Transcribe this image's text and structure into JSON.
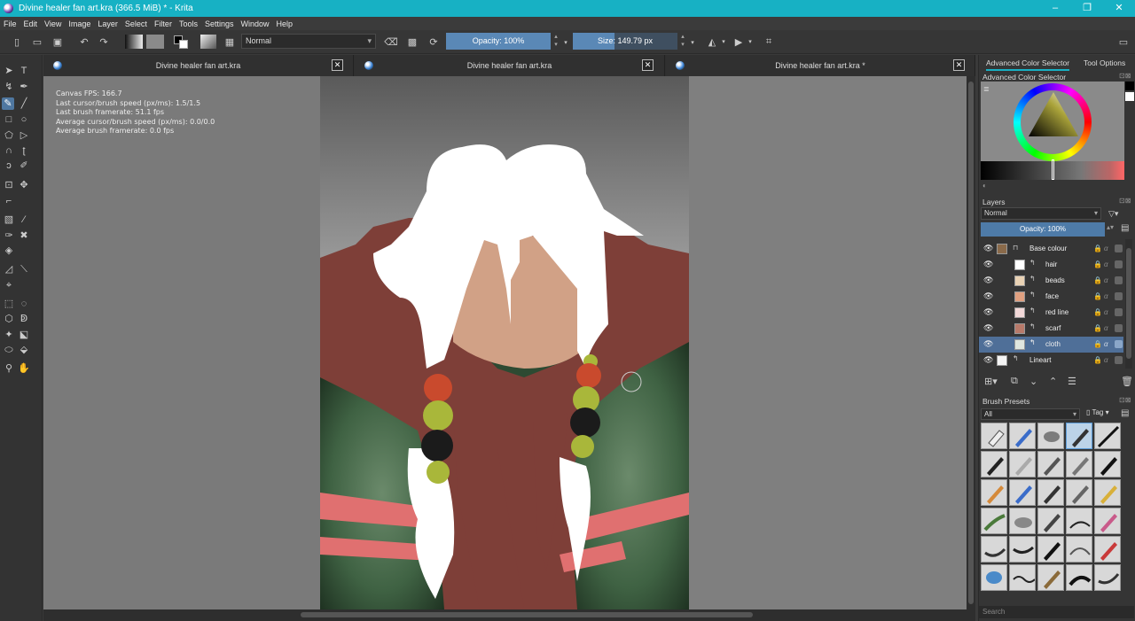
{
  "window": {
    "title": "Divine healer fan art.kra (366.5 MiB)  * - Krita",
    "controls": [
      "–",
      "❐",
      "✕"
    ]
  },
  "menu": [
    "File",
    "Edit",
    "View",
    "Image",
    "Layer",
    "Select",
    "Filter",
    "Tools",
    "Settings",
    "Window",
    "Help"
  ],
  "toolbar": {
    "blend_mode": "Normal",
    "opacity_label": "Opacity:  100%",
    "opacity_value": 1.0,
    "size_label": "Size:  149.79 px",
    "size_fill_fraction": 0.4
  },
  "documents": [
    {
      "title": "Divine healer fan art.kra"
    },
    {
      "title": "Divine healer fan art.kra"
    },
    {
      "title": "Divine healer fan art.kra *"
    }
  ],
  "stats": [
    "Canvas FPS: 166.7",
    "Last cursor/brush speed (px/ms): 1.5/1.5",
    "Last brush framerate: 51.1 fps",
    "Average cursor/brush speed (px/ms): 0.0/0.0",
    "Average brush framerate: 0.0 fps"
  ],
  "dock": {
    "tabs": [
      "Advanced Color Selector",
      "Tool Options"
    ],
    "color_selector_title": "Advanced Color Selector",
    "layers_title": "Layers",
    "layers_blend": "Normal",
    "layers_opacity": "Opacity:  100%",
    "layers": [
      {
        "name": "Base colour",
        "kind": "group",
        "selected": false
      },
      {
        "name": "hair",
        "kind": "paint",
        "selected": false
      },
      {
        "name": "beads",
        "kind": "paint",
        "selected": false
      },
      {
        "name": "face",
        "kind": "paint",
        "selected": false
      },
      {
        "name": "red line",
        "kind": "paint",
        "selected": false
      },
      {
        "name": "scarf",
        "kind": "paint",
        "selected": false
      },
      {
        "name": "cloth",
        "kind": "paint",
        "selected": true
      },
      {
        "name": "Lineart",
        "kind": "paint",
        "selected": false
      }
    ],
    "brush_presets_title": "Brush Presets",
    "brush_filter": "All",
    "tag_label": "Tag",
    "search_placeholder": "Search"
  },
  "colors": {
    "titlebar": "#17b1c4",
    "accent": "#4f77a0",
    "background_coat": "#7e3f38",
    "hair": "#ffffff",
    "skin": "#d1a186",
    "cloth_green": "#3f6243",
    "stripe_red": "#e07070"
  }
}
